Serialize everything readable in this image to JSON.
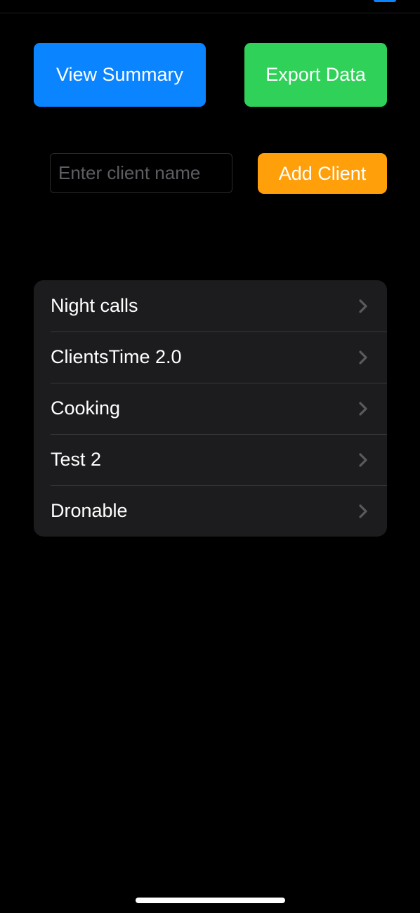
{
  "colors": {
    "background": "#000000",
    "summary_button": "#0a84ff",
    "export_button": "#30d158",
    "add_button": "#ff9f0a",
    "list_background": "#1c1c1e",
    "separator": "#38383a",
    "chevron": "#5a5a5e",
    "text": "#ffffff",
    "placeholder": "#5d5d62"
  },
  "actions": {
    "view_summary_label": "View Summary",
    "export_data_label": "Export Data"
  },
  "add_client": {
    "input_value": "",
    "input_placeholder": "Enter client name",
    "button_label": "Add Client"
  },
  "clients": [
    {
      "name": "Night calls",
      "icon": "chevron-right-icon"
    },
    {
      "name": "ClientsTime 2.0",
      "icon": "chevron-right-icon"
    },
    {
      "name": "Cooking",
      "icon": "chevron-right-icon"
    },
    {
      "name": "Test 2",
      "icon": "chevron-right-icon"
    },
    {
      "name": "Dronable",
      "icon": "chevron-right-icon"
    }
  ]
}
